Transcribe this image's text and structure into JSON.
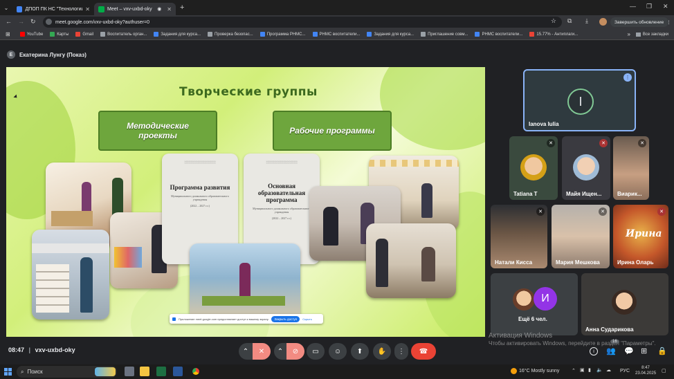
{
  "tabs": [
    {
      "label": "ДПОП ПК НС \"Технологии ра",
      "active": false
    },
    {
      "label": "Meet – vxv-uxbd-oky",
      "active": true
    }
  ],
  "address": {
    "url": "meet.google.com/vxv-uxbd-oky?authuser=0"
  },
  "toolbar": {
    "update_label": "Завершить обновление"
  },
  "bookmarks": [
    {
      "label": "YouTube",
      "color": "#ff0000"
    },
    {
      "label": "Карты",
      "color": "#34a853"
    },
    {
      "label": "Gmail",
      "color": "#ea4335"
    },
    {
      "label": "Воспитатель орган...",
      "color": "#9aa0a6"
    },
    {
      "label": "Задания для курса...",
      "color": "#4285f4"
    },
    {
      "label": "Проверка безопас...",
      "color": "#9aa0a6"
    },
    {
      "label": "Программа РНМС...",
      "color": "#4285f4"
    },
    {
      "label": "РНМС воспитатели...",
      "color": "#4285f4"
    },
    {
      "label": "Задания для курса...",
      "color": "#4285f4"
    },
    {
      "label": "Приглашение совм...",
      "color": "#9aa0a6"
    },
    {
      "label": "РНМС воспитатели...",
      "color": "#4285f4"
    },
    {
      "label": "15.77% - Антиплаги...",
      "color": "#ea4335"
    }
  ],
  "bookmarks_all": "Все закладки",
  "presenter": {
    "initial": "Е",
    "label": "Екатерина Лунгу (Показ)"
  },
  "slide": {
    "title": "Творческие группы",
    "box_left": "Методические проекты",
    "box_right": "Рабочие программы",
    "doc1_title": "Программа развития",
    "doc1_sub": "Муниципального дошкольного образовательного учреждения",
    "doc1_years": "(2022 – 2027 г.г.)",
    "doc2_title": "Основная образовательная программа",
    "doc2_sub": "Муниципального дошкольного образовательного учреждения",
    "doc2_years": "(2022 – 2027 г.г.)",
    "permission_text": "Приложение meet.google.com предоставляет доступ к вашему экрану.",
    "permission_button": "Закрыть доступ",
    "permission_hide": "Скрыть"
  },
  "participants": [
    {
      "name": "Ianova Iulia",
      "initial": "I"
    },
    {
      "name": "Tatiana T"
    },
    {
      "name": "Майя Ищен..."
    },
    {
      "name": "Виарик..."
    },
    {
      "name": "Натали Кисса"
    },
    {
      "name": "Мария Мешкова"
    },
    {
      "name": "Ирина Оларь",
      "logo": "Ирина"
    },
    {
      "name": "Ещё 6 чел.",
      "initial": "И"
    },
    {
      "name": "Анна Сударикова"
    }
  ],
  "watermark": {
    "line1": "Активация Windows",
    "line2": "Чтобы активировать Windows, перейдите в раздел \"Параметры\"."
  },
  "meeting": {
    "time": "08:47",
    "code": "vxv-uxbd-oky",
    "people_count": "16"
  },
  "taskbar": {
    "search": "Поиск",
    "weather": "16°C  Mostly sunny",
    "lang": "РУС",
    "clock_time": "8:47",
    "clock_date": "23.04.2025"
  }
}
